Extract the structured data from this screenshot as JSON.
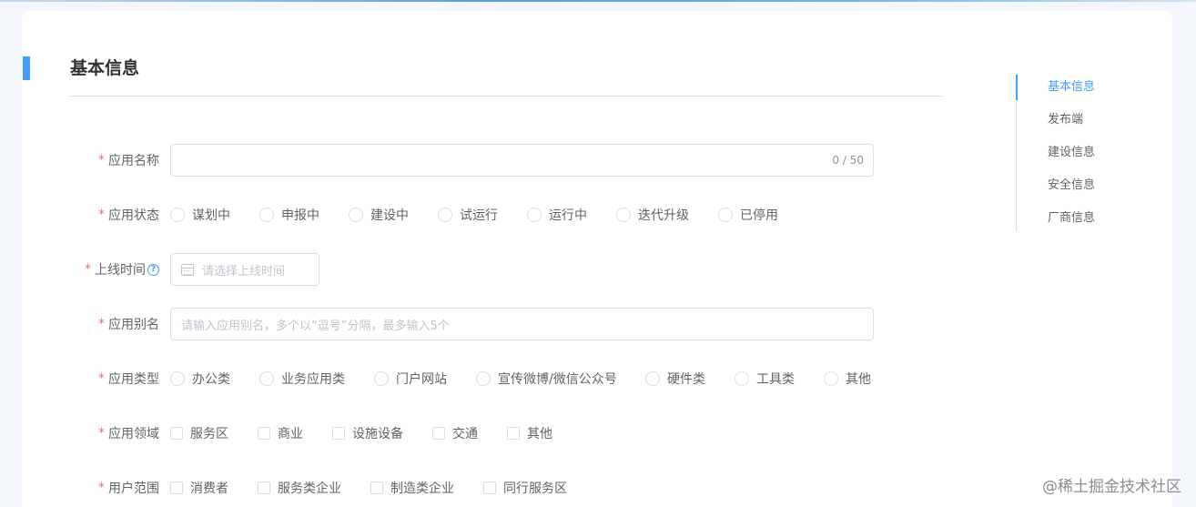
{
  "section": {
    "title": "基本信息"
  },
  "fields": {
    "app_name": {
      "label": "应用名称",
      "value": "",
      "counter": "0 / 50"
    },
    "app_status": {
      "label": "应用状态",
      "options": [
        "谋划中",
        "申报中",
        "建设中",
        "试运行",
        "运行中",
        "迭代升级",
        "已停用"
      ]
    },
    "launch_time": {
      "label": "上线时间",
      "help": "?",
      "placeholder": "请选择上线时间"
    },
    "app_alias": {
      "label": "应用别名",
      "placeholder": "请输入应用别名，多个以“逗号”分隔，最多输入5个"
    },
    "app_type": {
      "label": "应用类型",
      "options": [
        "办公类",
        "业务应用类",
        "门户网站",
        "宣传微博/微信公众号",
        "硬件类",
        "工具类",
        "其他"
      ]
    },
    "app_domain": {
      "label": "应用领域",
      "options": [
        "服务区",
        "商业",
        "设施设备",
        "交通",
        "其他"
      ]
    },
    "user_scope": {
      "label": "用户范围",
      "options": [
        "消费者",
        "服务类企业",
        "制造类企业",
        "同行服务区"
      ]
    }
  },
  "required_mark": "*",
  "anchor_nav": {
    "items": [
      "基本信息",
      "发布端",
      "建设信息",
      "安全信息",
      "厂商信息"
    ],
    "active_index": 0
  },
  "watermark": "@稀土掘金技术社区",
  "colors": {
    "primary": "#409eff",
    "required": "#f56c6c"
  }
}
